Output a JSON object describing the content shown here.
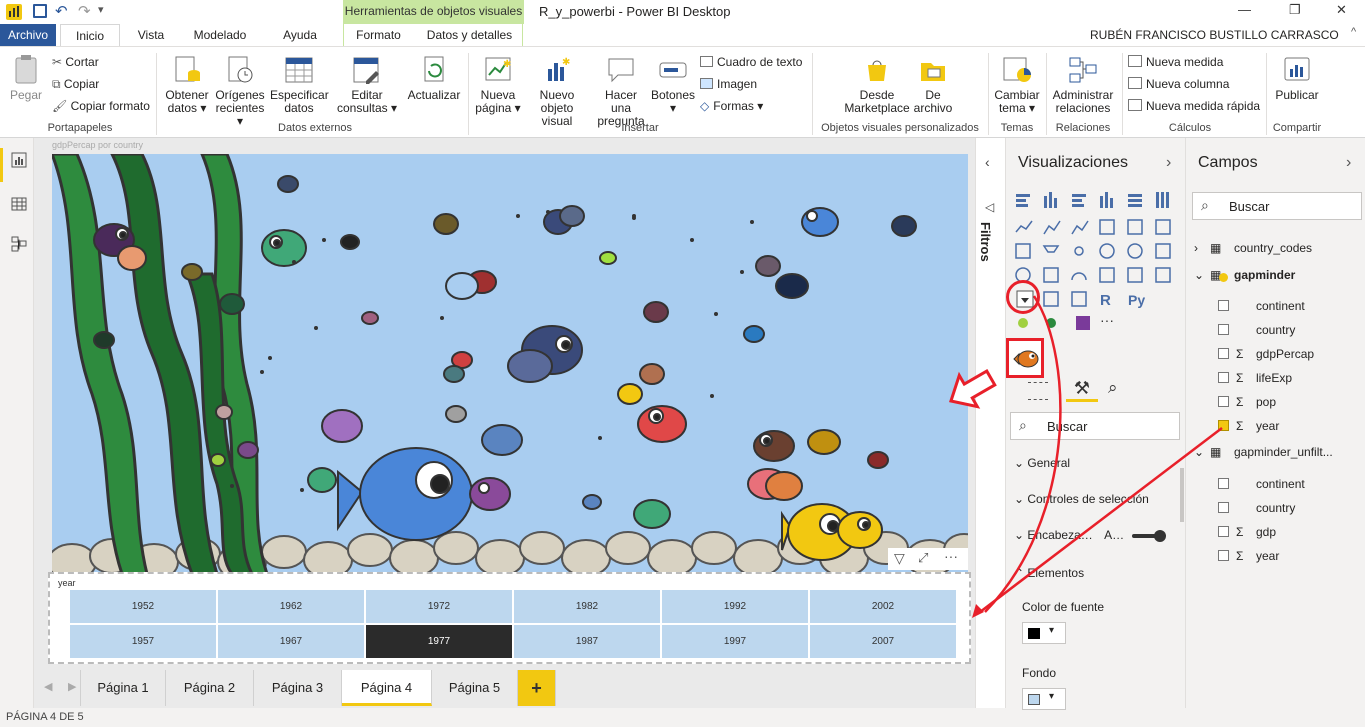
{
  "titlebar": {
    "doc_title": "R_y_powerbi - Power BI Desktop",
    "context_tab": "Herramientas de objetos visuales"
  },
  "window": {
    "minimize": "—",
    "restore": "❐",
    "close": "✕"
  },
  "user": {
    "name": "RUBÉN FRANCISCO BUSTILLO CARRASCO"
  },
  "tabs": {
    "archivo": "Archivo",
    "inicio": "Inicio",
    "vista": "Vista",
    "modelado": "Modelado",
    "ayuda": "Ayuda",
    "formato": "Formato",
    "datos": "Datos y detalles"
  },
  "ribbon": {
    "pegar": "Pegar",
    "cortar": "Cortar",
    "copiar": "Copiar",
    "copiar_formato": "Copiar formato",
    "portapapeles": "Portapapeles",
    "obtener": "Obtener datos ▾",
    "origenes": "Orígenes recientes ▾",
    "especificar": "Especificar datos",
    "editar": "Editar consultas ▾",
    "actualizar": "Actualizar",
    "datos_externos": "Datos externos",
    "nueva_pagina": "Nueva página ▾",
    "nuevo_objeto": "Nuevo objeto visual",
    "hacer_pregunta": "Hacer una pregunta",
    "botones": "Botones ▾",
    "cuadro_texto": "Cuadro de texto",
    "imagen": "Imagen",
    "formas": "Formas ▾",
    "insertar": "Insertar",
    "desde_marketplace": "Desde Marketplace",
    "de_archivo": "De archivo",
    "objetos_personalizados": "Objetos visuales personalizados",
    "cambiar_tema": "Cambiar tema ▾",
    "temas": "Temas",
    "administrar": "Administrar relaciones",
    "relaciones": "Relaciones",
    "nueva_medida": "Nueva medida",
    "nueva_columna": "Nueva columna",
    "nueva_medida_rapida": "Nueva medida rápida",
    "calculos": "Cálculos",
    "publicar": "Publicar",
    "compartir": "Compartir"
  },
  "canvas": {
    "visual_title": "gdpPercap por country",
    "slicer_title": "year"
  },
  "slicer": {
    "years": [
      "1952",
      "1962",
      "1972",
      "1982",
      "1992",
      "2002",
      "1957",
      "1967",
      "1977",
      "1987",
      "1997",
      "2007"
    ],
    "selected": "1977"
  },
  "pages": {
    "p1": "Página 1",
    "p2": "Página 2",
    "p3": "Página 3",
    "p4": "Página 4",
    "p5": "Página 5",
    "add": "+",
    "active": "Página 4"
  },
  "status": {
    "text": "PÁGINA 4 DE 5"
  },
  "filters": {
    "label": "Filtros"
  },
  "visualizations": {
    "title": "Visualizaciones",
    "search_placeholder": "Buscar",
    "sections": {
      "general": "General",
      "controles": "Controles de selección",
      "encabezado": "Encabeza…",
      "encabezado_extra": "A…",
      "elementos": "Elementos"
    },
    "font_color_label": "Color de fuente",
    "background_label": "Fondo",
    "more": "···",
    "font_color": "#000000",
    "background_color": "#bdd7ee"
  },
  "fields": {
    "title": "Campos",
    "search_placeholder": "Buscar",
    "tables": {
      "country_codes": "country_codes",
      "gapminder": "gapminder",
      "gapminder_unfilt": "gapminder_unfilt..."
    },
    "gapminder_fields": {
      "continent": "continent",
      "country": "country",
      "gdpPercap": "gdpPercap",
      "lifeExp": "lifeExp",
      "pop": "pop",
      "year": "year"
    },
    "unfilt_fields": {
      "continent": "continent",
      "country": "country",
      "gdp": "gdp",
      "year": "year"
    },
    "sigma": "Σ"
  },
  "colors": {
    "accent": "#f2c811",
    "archivo": "#2b579a",
    "highlight": "#e8202a",
    "water": "#a9cdf0"
  }
}
